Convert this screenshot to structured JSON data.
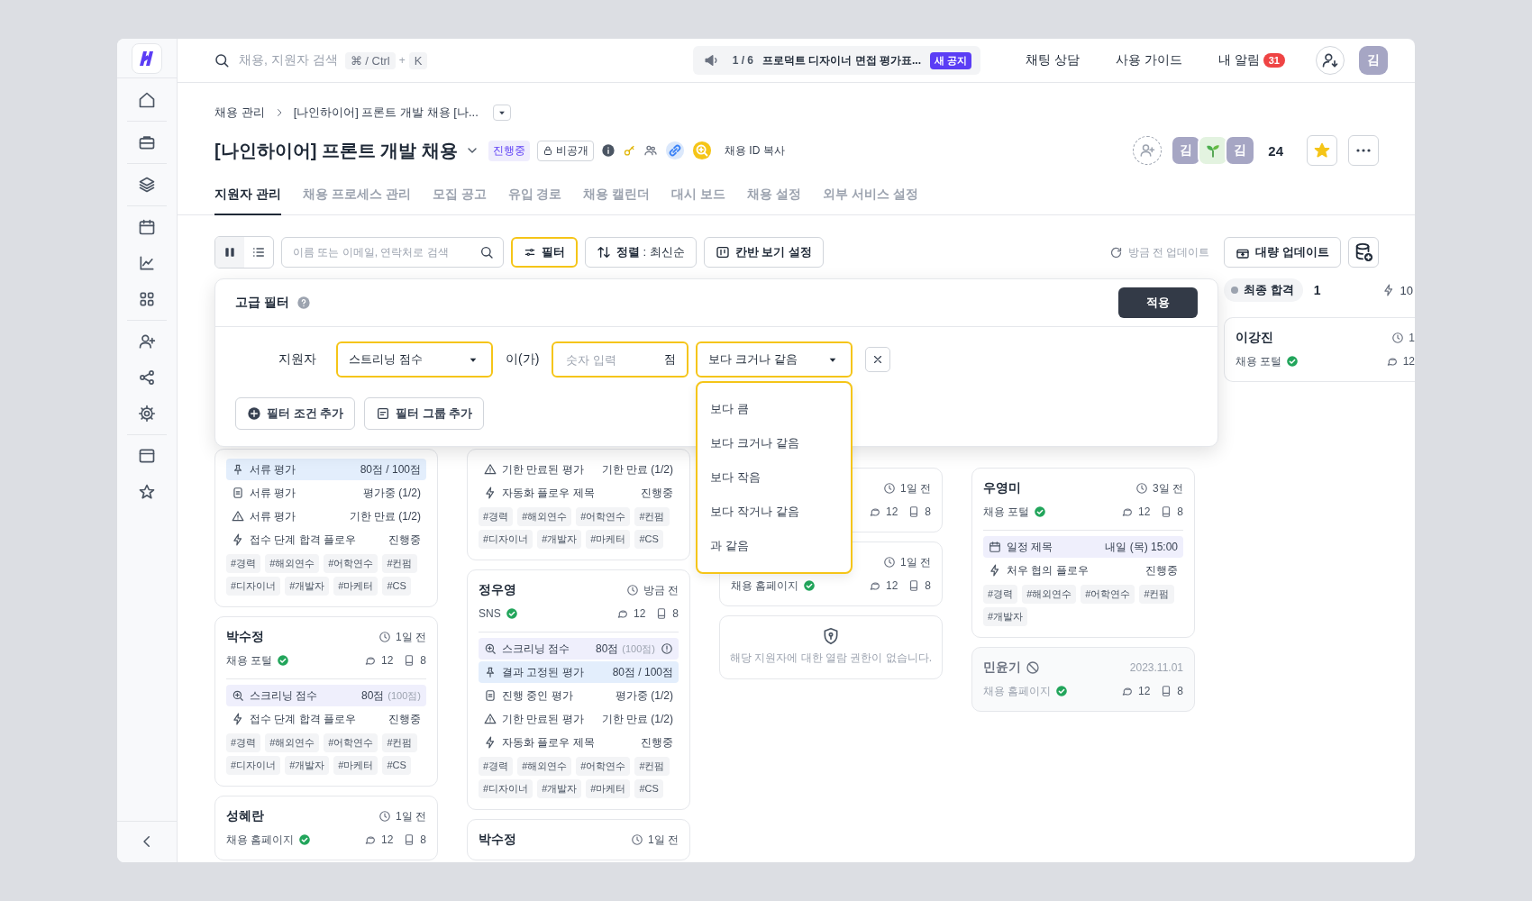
{
  "top_bar": {
    "search": {
      "placeholder": "채용, 지원자 검색",
      "keys": [
        "⌘ / Ctrl",
        "K"
      ],
      "joiner": "+"
    },
    "notice": {
      "counter": "1 / 6",
      "text": "프로덕트 디자이너 면접 평가표...",
      "badge": "새 공지"
    },
    "links": [
      "채팅 상담",
      "사용 가이드"
    ],
    "notifications": {
      "label": "내 알림",
      "count": "31"
    },
    "avatar": "김"
  },
  "header": {
    "breadcrumb": [
      "채용 관리",
      "[나인하이어] 프론트 개발 채용 [나..."
    ],
    "title": "[나인하이어] 프론트 개발 채용",
    "status": "진행중",
    "visibility": "비공개",
    "copy_id": "채용 ID 복사",
    "members": [
      {
        "kind": "initial",
        "text": "김"
      },
      {
        "kind": "sprout"
      },
      {
        "kind": "initial",
        "text": "김"
      }
    ],
    "member_count": "24",
    "favorite": true
  },
  "tabs": [
    {
      "label": "지원자 관리",
      "selected": true
    },
    {
      "label": "채용 프로세스 관리",
      "selected": false
    },
    {
      "label": "모집 공고",
      "selected": false
    },
    {
      "label": "유입 경로",
      "selected": false
    },
    {
      "label": "채용 캘린더",
      "selected": false
    },
    {
      "label": "대시 보드",
      "selected": false
    },
    {
      "label": "채용 설정",
      "selected": false
    },
    {
      "label": "외부 서비스 설정",
      "selected": false
    }
  ],
  "toolbar": {
    "view_modes": [
      {
        "kind": "kanban",
        "selected": true
      },
      {
        "kind": "list",
        "selected": false
      }
    ],
    "search": {
      "placeholder": "이름 또는 이메일, 연락처로 검색"
    },
    "filter_button": {
      "label": "필터",
      "highlighted": true
    },
    "sort": "**정렬** : 최신순",
    "board_settings": "칸반 보기 설정",
    "updated": "방금 전 업데이트",
    "bulk_update": "대량 업데이트"
  },
  "filter_panel": {
    "title": "고급 필터",
    "apply": "적용",
    "condition": {
      "subject": "지원자",
      "field": {
        "value": "스트리닝 점수",
        "highlighted": true
      },
      "particle": "이(가)",
      "number": {
        "placeholder": "숫자 입력",
        "unit": "점",
        "highlighted": true
      },
      "operator": {
        "value": "보다 크거나 같음",
        "highlighted": true,
        "expanded": true
      }
    },
    "operator_options": {
      "highlighted": true,
      "items": [
        "보다 큼",
        "보다 크거나 같음",
        "보다 작음",
        "보다 작거나 같음",
        "과 같음"
      ]
    },
    "add_buttons": [
      {
        "kind": "condition",
        "label": "필터 조건 추가"
      },
      {
        "kind": "group",
        "label": "필터 그룹 추가"
      }
    ]
  },
  "board": {
    "columns": [
      {
        "cards": [
          {
            "rows": [
              {
                "kind": "pinned",
                "label": "서류 평가",
                "value": "80점 / 100점"
              },
              {
                "kind": "evaluation",
                "label": "서류 평가",
                "value": "평가중 (1/2)"
              },
              {
                "kind": "expired",
                "label": "서류 평가",
                "value": "기한 만료 (1/2)"
              },
              {
                "kind": "flow",
                "label": "접수 단계 합격 플로우",
                "value": "진행중"
              }
            ],
            "tags": [
              "#경력",
              "#해외연수",
              "#어학연수",
              "#컨펌",
              "#디자이너",
              "#개발자",
              "#마케터",
              "#CS"
            ]
          },
          {
            "name": "박수정",
            "time": "1일 전",
            "source": "채용 포털",
            "verified": true,
            "comments": "12",
            "files": "8",
            "rows": [
              {
                "kind": "screening",
                "label": "스크리닝 점수",
                "value": "80점",
                "max": "(100점)",
                "alert": false
              },
              {
                "kind": "flow",
                "label": "접수 단계 합격 플로우",
                "value": "진행중"
              }
            ],
            "tags": [
              "#경력",
              "#해외연수",
              "#어학연수",
              "#컨펌",
              "#디자이너",
              "#개발자",
              "#마케터",
              "#CS"
            ]
          },
          {
            "name": "성혜란",
            "time": "1일 전",
            "source": "채용 홈페이지",
            "verified": true,
            "comments": "12",
            "files": "8"
          }
        ]
      },
      {
        "cards": [
          {
            "rows": [
              {
                "kind": "expired",
                "label": "기한 만료된 평가",
                "value": "기한 만료 (1/2)"
              },
              {
                "kind": "flow",
                "label": "자동화 플로우 제목",
                "value": "진행중"
              }
            ],
            "tags": [
              "#경력",
              "#해외연수",
              "#어학연수",
              "#컨펌",
              "#디자이너",
              "#개발자",
              "#마케터",
              "#CS"
            ]
          },
          {
            "name": "정우영",
            "time": "방금 전",
            "source": "SNS",
            "verified": true,
            "comments": "12",
            "files": "8",
            "rows": [
              {
                "kind": "screening",
                "label": "스크리닝 점수",
                "value": "80점",
                "max": "(100점)",
                "alert": true
              },
              {
                "kind": "pinned",
                "label": "결과 고정된 평가",
                "value": "80점 / 100점"
              },
              {
                "kind": "evaluation",
                "label": "진행 중인 평가",
                "value": "평가중 (1/2)"
              },
              {
                "kind": "expired",
                "label": "기한 만료된 평가",
                "value": "기한 만료 (1/2)"
              },
              {
                "kind": "flow",
                "label": "자동화 플로우 제목",
                "value": "진행중"
              }
            ],
            "tags": [
              "#경력",
              "#해외연수",
              "#어학연수",
              "#컨펌",
              "#디자이너",
              "#개발자",
              "#마케터",
              "#CS"
            ]
          },
          {
            "name": "박수정",
            "time": "1일 전"
          }
        ]
      },
      {
        "cards": [
          {
            "time": "1일 전",
            "comments": "12",
            "files": "8"
          },
          {
            "time": "1일 전",
            "source": "채용 홈페이지",
            "verified": true,
            "comments": "12",
            "files": "8"
          },
          {
            "kind": "locked",
            "message": "해당 지원자에 대한 열람 권한이 없습니다."
          }
        ]
      },
      {
        "cards": [
          {
            "name": "우영미",
            "time": "3일 전",
            "source": "채용 포털",
            "verified": true,
            "comments": "12",
            "files": "8",
            "rows": [
              {
                "kind": "schedule",
                "label": "일정 제목",
                "value": "내일 (목) 15:00"
              },
              {
                "kind": "flow",
                "label": "처우 협의 플로우",
                "value": "진행중"
              }
            ],
            "tags": [
              "#경력",
              "#해외연수",
              "#어학연수",
              "#컨펌",
              "#개발자"
            ]
          },
          {
            "name": "민윤기",
            "disabled": true,
            "date": "2023.11.01",
            "source": "채용 홈페이지",
            "verified": true,
            "comments": "12",
            "files": "8"
          }
        ]
      },
      {
        "header": {
          "label": "최종 합격",
          "count": "1",
          "automations": "10"
        },
        "cards": [
          {
            "name": "이강진",
            "time": "1",
            "source": "채용 포털",
            "verified": true,
            "comments": "12"
          }
        ]
      }
    ]
  }
}
